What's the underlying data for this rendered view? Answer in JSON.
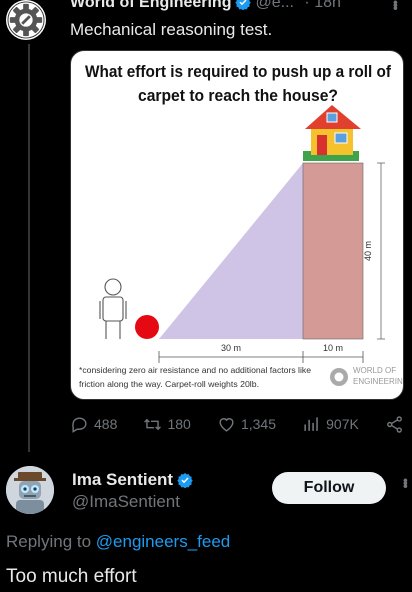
{
  "tweet": {
    "author_name": "World of Engineering",
    "author_handle": "@e...",
    "separator": "·",
    "time": "18h",
    "text": "Mechanical reasoning test.",
    "image": {
      "title_line1": "What effort is required to push up a roll of",
      "title_line2": "carpet to reach the house?",
      "label_height": "40 m",
      "label_base": "30 m",
      "label_width": "10 m",
      "note_line1": "*considering zero air resistance and no additional factors like",
      "note_line2": "friction along the way. Carpet-roll weights 20lb.",
      "watermark_line1": "WORLD OF",
      "watermark_line2": "ENGINEERING"
    },
    "metrics": {
      "replies": "488",
      "reposts": "180",
      "likes": "1,345",
      "views": "907K"
    }
  },
  "reply": {
    "author_name": "Ima Sentient",
    "author_handle": "@ImaSentient",
    "follow_label": "Follow",
    "replying_prefix": "Replying to ",
    "replying_mention": "@engineers_feed",
    "text": "Too much effort"
  },
  "colors": {
    "background": "#000000",
    "text": "#e7e9ea",
    "muted": "#71767b",
    "link": "#1d9bf0",
    "verified": "#1d9bf0",
    "ramp": "#cfc3e6",
    "building": "#d49a96",
    "ball": "#e50914"
  },
  "icons": [
    "gear-logo-icon",
    "verified-icon",
    "reply-icon",
    "repost-icon",
    "like-icon",
    "views-icon",
    "share-icon",
    "more-icon"
  ]
}
